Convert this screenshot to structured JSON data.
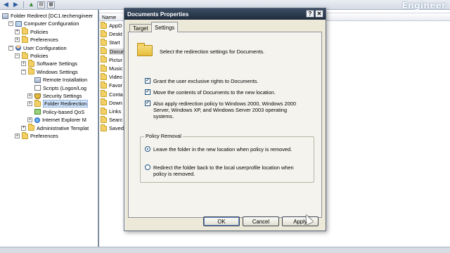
{
  "watermark": "Engineer",
  "tree": {
    "items": [
      {
        "label": "Folder Redirect [DC1.techengineer",
        "indent": 0,
        "expander": "none",
        "icon": "gp"
      },
      {
        "label": "Computer Configuration",
        "indent": 1,
        "expander": "-",
        "icon": "pc"
      },
      {
        "label": "Policies",
        "indent": 2,
        "expander": "+",
        "icon": "folder"
      },
      {
        "label": "Preferences",
        "indent": 2,
        "expander": "+",
        "icon": "folder"
      },
      {
        "label": "User Configuration",
        "indent": 1,
        "expander": "-",
        "icon": "user"
      },
      {
        "label": "Policies",
        "indent": 2,
        "expander": "-",
        "icon": "folder"
      },
      {
        "label": "Software Settings",
        "indent": 3,
        "expander": "+",
        "icon": "folder"
      },
      {
        "label": "Windows Settings",
        "indent": 3,
        "expander": "-",
        "icon": "folder"
      },
      {
        "label": "Remote Installation",
        "indent": 4,
        "expander": "none",
        "icon": "gp"
      },
      {
        "label": "Scripts (Logon/Log",
        "indent": 4,
        "expander": "none",
        "icon": "script"
      },
      {
        "label": "Security Settings",
        "indent": 4,
        "expander": "+",
        "icon": "shield"
      },
      {
        "label": "Folder Redirection",
        "indent": 4,
        "expander": "+",
        "icon": "folder",
        "selected": true
      },
      {
        "label": "Policy-based QoS",
        "indent": 4,
        "expander": "none",
        "icon": "qos"
      },
      {
        "label": "Internet Explorer M",
        "indent": 4,
        "expander": "+",
        "icon": "ie"
      },
      {
        "label": "Administrative Templat",
        "indent": 3,
        "expander": "+",
        "icon": "folder"
      },
      {
        "label": "Preferences",
        "indent": 2,
        "expander": "+",
        "icon": "folder"
      }
    ]
  },
  "list": {
    "header": "Name",
    "items": [
      {
        "label": "AppD"
      },
      {
        "label": "Deskt"
      },
      {
        "label": "Start"
      },
      {
        "label": "Docum",
        "selected": true
      },
      {
        "label": "Pictur"
      },
      {
        "label": "Music"
      },
      {
        "label": "Video"
      },
      {
        "label": "Favor"
      },
      {
        "label": "Conta"
      },
      {
        "label": "Down"
      },
      {
        "label": "Links"
      },
      {
        "label": "Searc"
      },
      {
        "label": "Saved"
      }
    ]
  },
  "dialog": {
    "title": "Documents Properties",
    "help_label": "?",
    "close_label": "✕",
    "tabs": {
      "target": "Target",
      "settings": "Settings"
    },
    "intro": "Select the redirection settings for Documents.",
    "options": [
      {
        "label": "Grant the user exclusive rights to Documents.",
        "checked": true
      },
      {
        "label": "Move the contents of Documents to the new location.",
        "checked": true
      },
      {
        "label": "Also apply redirection policy to Windows 2000, Windows 2000 Server, Windows XP, and Windows Server 2003 operating systems.",
        "checked": true
      }
    ],
    "policy_removal": {
      "legend": "Policy Removal",
      "leave": "Leave the folder in the new location when policy is removed.",
      "redirect": "Redirect the folder back to the local userprofile location when policy is removed.",
      "selected": "leave"
    },
    "buttons": {
      "ok": "OK",
      "cancel": "Cancel",
      "apply": "Apply"
    }
  }
}
